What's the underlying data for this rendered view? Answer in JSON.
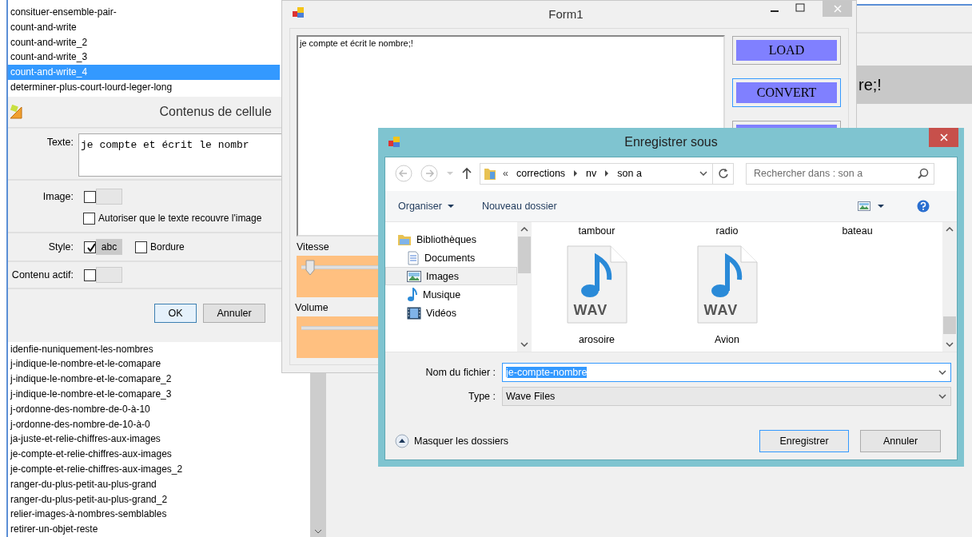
{
  "top_list": {
    "items": [
      {
        "label": "consituer-ensemble-pair-",
        "selected": false
      },
      {
        "label": "count-and-write",
        "selected": false
      },
      {
        "label": "count-and-write_2",
        "selected": false
      },
      {
        "label": "count-and-write_3",
        "selected": false
      },
      {
        "label": "count-and-write_4",
        "selected": true
      },
      {
        "label": "determiner-plus-court-lourd-leger-long",
        "selected": false
      }
    ]
  },
  "cell_dialog": {
    "title": "Contenus de cellule",
    "text_label": "Texte:",
    "text_value": "je compte et écrit le nombr",
    "image_label": "Image:",
    "image_checked": false,
    "overlap_label": "Autoriser que le texte recouvre l'image",
    "overlap_checked": false,
    "style_label": "Style:",
    "style_checked": true,
    "style_sample": "abc",
    "border_label": "Bordure",
    "border_checked": false,
    "active_label": "Contenu actif:",
    "active_checked": false,
    "buttons": [
      "OK",
      "Annuler"
    ]
  },
  "bottom_list": {
    "items": [
      "idenfie-nuniquement-les-nombres",
      "j-indique-le-nombre-et-le-comapare",
      "j-indique-le-nombre-et-le-comapare_2",
      "j-indique-le-nombre-et-le-comapare_3",
      "j-ordonne-des-nombre-de-0-à-10",
      "j-ordonne-des-nombre-de-10-à-0",
      "ja-juste-et-relie-chiffres-aux-images",
      "je-compte-et-relie-chiffres-aux-images",
      "je-compte-et-relie-chiffres-aux-images_2",
      "ranger-du-plus-petit-au-plus-grand",
      "ranger-du-plus-petit-au-plus-grand_2",
      "relier-images-à-nombres-semblables",
      "retirer-un-objet-reste"
    ]
  },
  "background_app": {
    "text": "re;!"
  },
  "form1": {
    "title": "Form1",
    "text": "je compte et écrit le nombre;!",
    "buttons": [
      "LOAD",
      "CONVERT"
    ],
    "sliders": [
      {
        "label": "Vitesse",
        "level": 0.05
      },
      {
        "label": "Volume"
      }
    ]
  },
  "save_dialog": {
    "title": "Enregistrer sous",
    "path_prefix": "«",
    "path": [
      "corrections",
      "nv",
      "son a"
    ],
    "search": {
      "placeholder": "Rechercher dans : son a"
    },
    "toolbar": {
      "organize": "Organiser",
      "new_folder": "Nouveau dossier"
    },
    "nav": [
      {
        "label": "Bibliothèques",
        "kind": "library",
        "selected": false,
        "children": [
          {
            "label": "Documents",
            "kind": "document",
            "selected": false
          },
          {
            "label": "Images",
            "kind": "image",
            "selected": true
          },
          {
            "label": "Musique",
            "kind": "music",
            "selected": false
          },
          {
            "label": "Vidéos",
            "kind": "video",
            "selected": false
          }
        ]
      }
    ],
    "files": [
      {
        "name": "tambour"
      },
      {
        "name": "radio"
      },
      {
        "name": "bateau"
      },
      {
        "name": "arosoire",
        "badge": "WAV"
      },
      {
        "name": "Avion",
        "badge": "WAV"
      }
    ],
    "filename_label": "Nom du fichier :",
    "filename": "je-compte-nombre",
    "type_label": "Type :",
    "type": "Wave Files",
    "hide_folders": "Masquer les dossiers",
    "buttons": [
      "Enregistrer",
      "Annuler"
    ]
  }
}
